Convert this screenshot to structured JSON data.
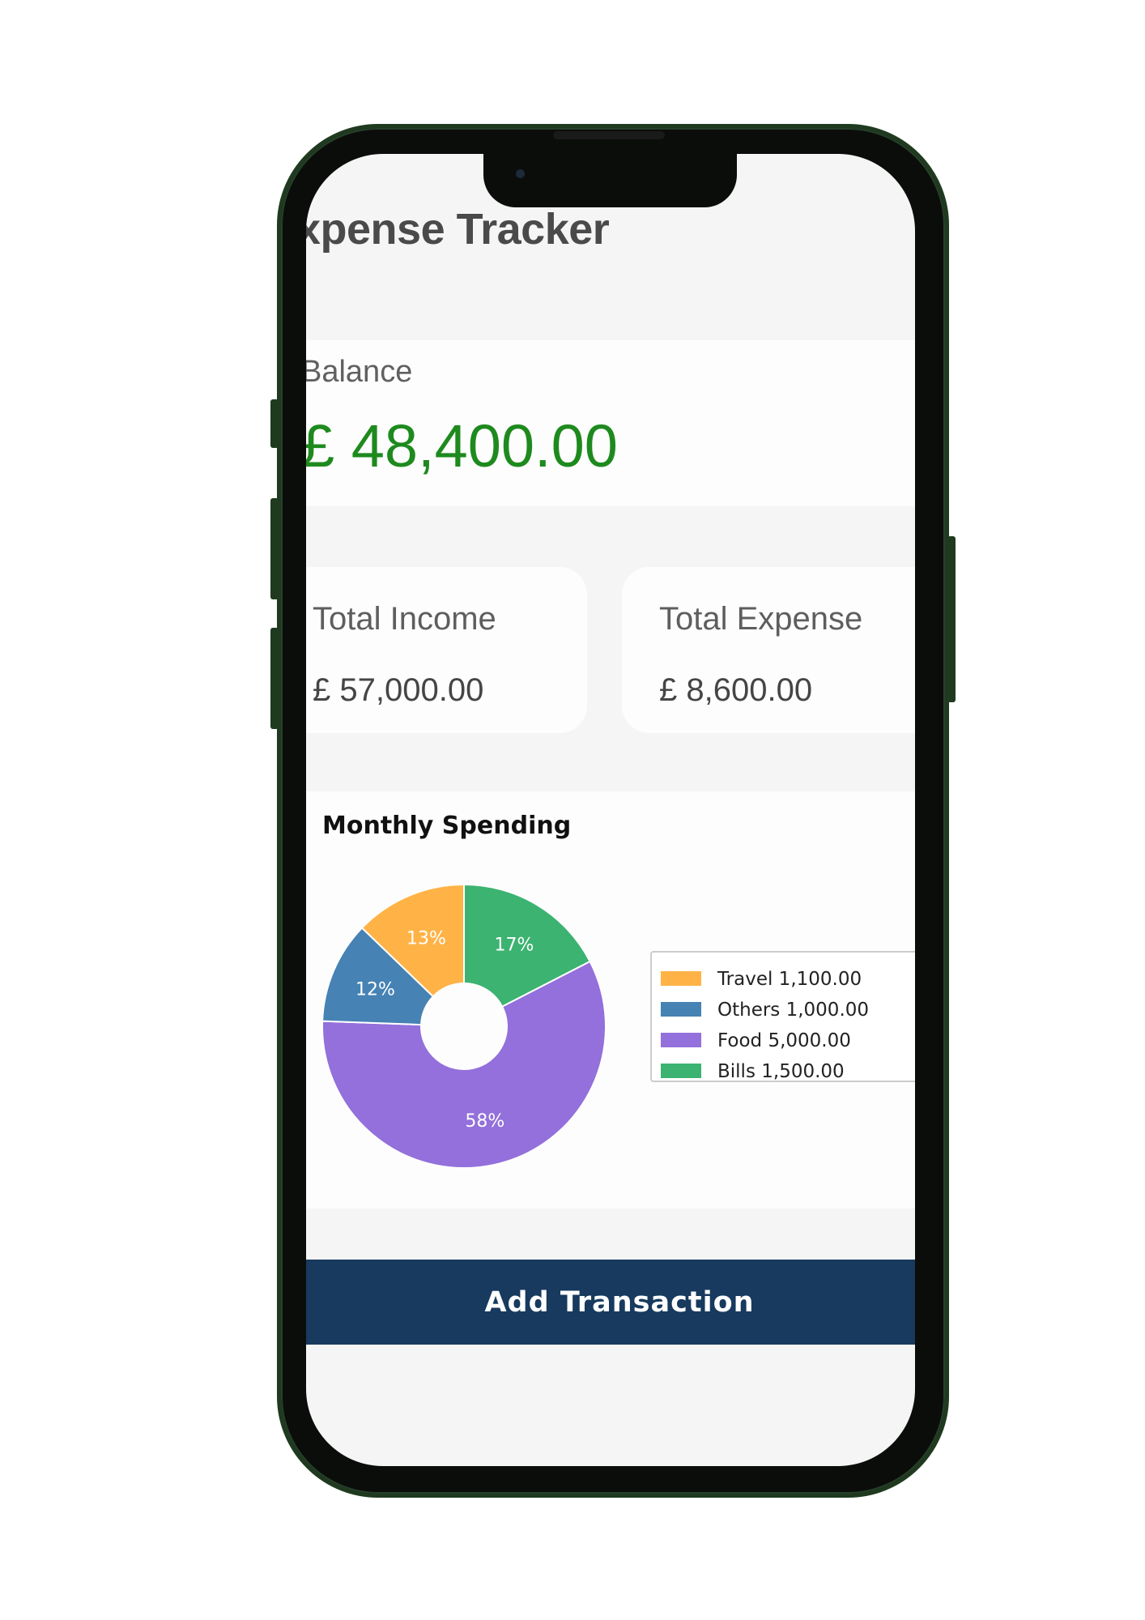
{
  "app": {
    "title": "xpense Tracker"
  },
  "balance": {
    "label": "Balance",
    "value": "£ 48,400.00",
    "color": "#1e8a1e"
  },
  "stats": {
    "income_label": "Total Income",
    "income_value": "£ 57,000.00",
    "expense_label": "Total Expense",
    "expense_value": "£ 8,600.00"
  },
  "chart_data": {
    "type": "pie",
    "title": "Monthly Spending",
    "donut": true,
    "legend_position": "right",
    "slices": [
      {
        "label": "Bills",
        "value": 1500.0,
        "value_text": "1,500.00",
        "percent_text": "17%",
        "color": "#3cb371"
      },
      {
        "label": "Food",
        "value": 5000.0,
        "value_text": "5,000.00",
        "percent_text": "58%",
        "color": "#9370db"
      },
      {
        "label": "Others",
        "value": 1000.0,
        "value_text": "1,000.00",
        "percent_text": "12%",
        "color": "#4682b4"
      },
      {
        "label": "Travel",
        "value": 1100.0,
        "value_text": "1,100.00",
        "percent_text": "13%",
        "color": "#ffb347"
      }
    ],
    "legend_order": [
      "Travel",
      "Others",
      "Food",
      "Bills"
    ]
  },
  "actions": {
    "add_transaction_label": "Add Transaction",
    "button_color": "#173a5e"
  }
}
